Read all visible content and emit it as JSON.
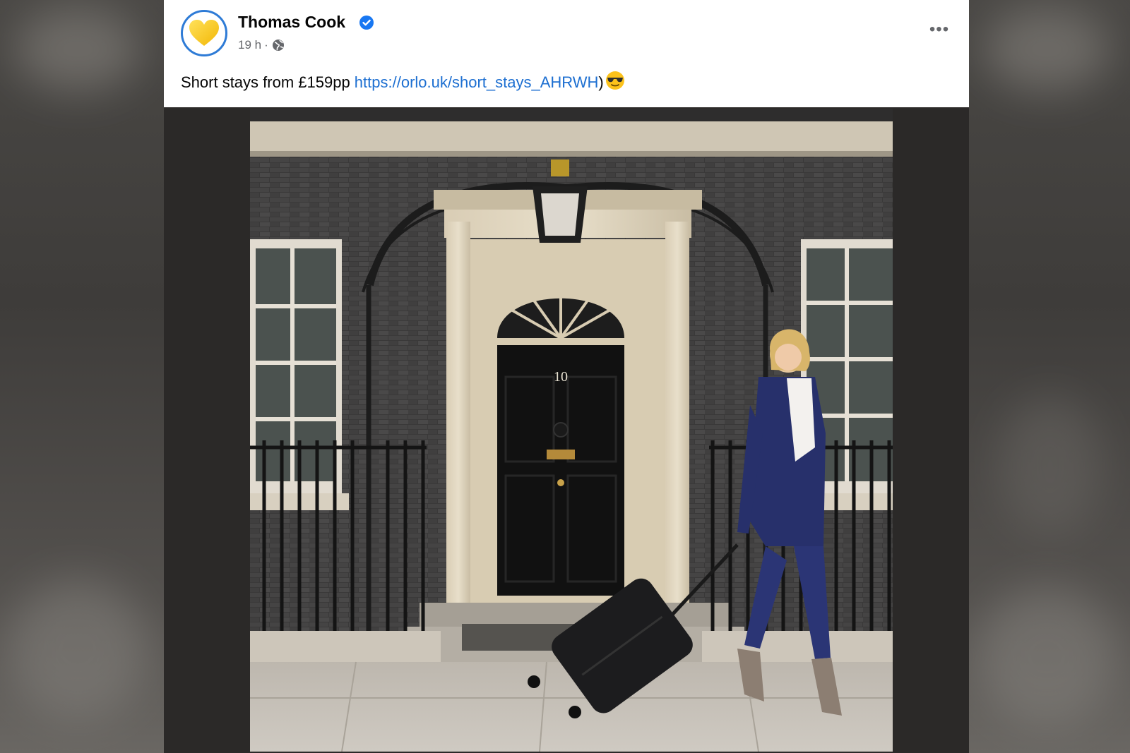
{
  "post": {
    "page_name": "Thomas Cook",
    "verified_icon": "verified-badge-icon",
    "time": "19 h",
    "separator": "·",
    "audience_icon": "globe-icon",
    "more_icon": "more-options-icon",
    "more_label": "•••",
    "text": "Short stays from £159pp ",
    "link": "https://orlo.uk/short_stays_AHRWH",
    "text_after_link": ")",
    "emoji_icon": "sunglasses-face-emoji",
    "photo_door_number": "10"
  },
  "colors": {
    "link": "#1d6fd1",
    "verified": "#1877f2",
    "avatar_ring": "#2e7bd6",
    "logo_heart": "#f5c518"
  }
}
